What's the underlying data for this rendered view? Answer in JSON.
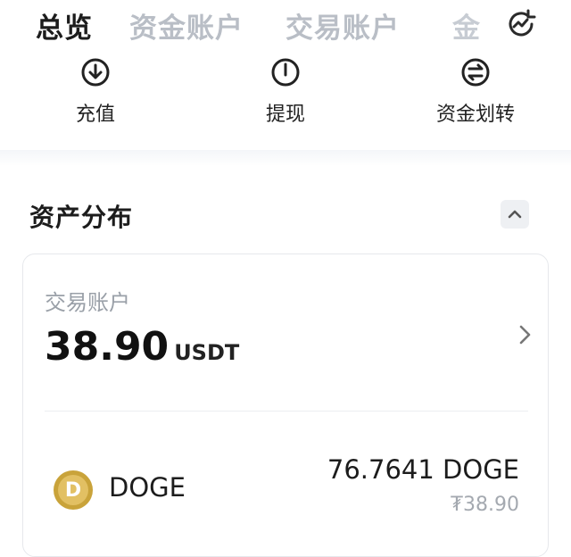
{
  "tabs": [
    {
      "label": "总览",
      "active": true
    },
    {
      "label": "资金账户",
      "active": false
    },
    {
      "label": "交易账户",
      "active": false
    },
    {
      "label": "金",
      "active": false
    }
  ],
  "icons": {
    "history": "history-icon",
    "deposit": "download-icon",
    "withdraw": "power-icon",
    "transfer": "transfer-icon",
    "collapse": "chevron-up-icon",
    "card_chevron": "chevron-right-icon",
    "coin": "doge-coin-icon"
  },
  "actions": {
    "deposit": "充值",
    "withdraw": "提现",
    "transfer": "资金划转"
  },
  "section": {
    "title": "资产分布"
  },
  "account_card": {
    "label": "交易账户",
    "amount": "38.90",
    "unit": "USDT"
  },
  "assets": [
    {
      "name": "DOGE",
      "quantity": "76.7641 DOGE",
      "value": "₮38.90",
      "coin_letter": "D"
    }
  ],
  "colors": {
    "active_tab": "#1c1c1c",
    "inactive_tab": "#b9bec6",
    "muted_text": "#9aa0a8",
    "coin": "#c9a33a"
  }
}
